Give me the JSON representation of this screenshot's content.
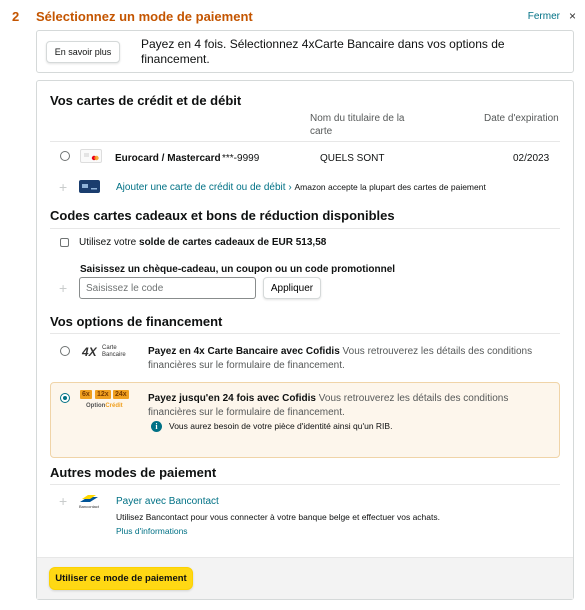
{
  "header": {
    "step_number": "2",
    "title": "Sélectionnez un mode de paiement",
    "close_label": "Fermer",
    "close_glyph": "×"
  },
  "info": {
    "learn_more_label": "En savoir plus",
    "text": "Payez en 4 fois. Sélectionnez 4xCarte Bancaire dans vos options de financement."
  },
  "cards": {
    "title": "Vos cartes de crédit et de débit",
    "col_holder": "Nom du titulaire de la carte",
    "col_expiry": "Date d'expiration",
    "rows": [
      {
        "name": "Eurocard / Mastercard",
        "number": "***-9999",
        "holder": "QUELS SONT",
        "expiry": "02/2023"
      }
    ],
    "add_card_label": "Ajouter une carte de crédit ou de débit",
    "add_card_separator": "›",
    "add_card_note": "Amazon accepte la plupart des cartes de paiement"
  },
  "gift": {
    "title": "Codes cartes cadeaux et bons de réduction disponibles",
    "use_balance_prefix": "Utilisez votre ",
    "use_balance_bold": "solde de cartes cadeaux de EUR 513,58",
    "enter_code_label": "Saisissez un chèque-cadeau, un coupon ou un code promotionnel",
    "input_placeholder": "Saisissez le code",
    "apply_label": "Appliquer"
  },
  "financing": {
    "title": "Vos options de financement",
    "options": [
      {
        "logo_main": "4X",
        "logo_line1": "Carte",
        "logo_line2": "Bancaire",
        "title": "Payez en 4x Carte Bancaire avec Cofidis",
        "desc_line1": " Vous retrouverez les détails des conditions",
        "desc_line2": "financières sur le formulaire de financement."
      },
      {
        "logo_badges": [
          "6x",
          "12x",
          "24x"
        ],
        "logo_option": "Option",
        "logo_credit": "Crédit",
        "title": "Payez jusqu'en 24 fois avec Cofidis",
        "desc_line1": " Vous retrouverez les détails des conditions",
        "desc_line2": "financières sur le formulaire de financement.",
        "note": "Vous aurez besoin de votre pièce d'identité ainsi qu'un RIB.",
        "info_glyph": "i"
      }
    ]
  },
  "other": {
    "title": "Autres modes de paiement",
    "bancontact_label": "Payer avec Bancontact",
    "bancontact_logo_text": "Bancontact",
    "bancontact_desc": "Utilisez Bancontact pour vous connecter à votre banque belge et effectuer vos achats.",
    "more_info": "Plus d'informations"
  },
  "footer": {
    "submit_label": "Utiliser ce mode de paiement"
  },
  "glyphs": {
    "plus": "+"
  },
  "colors": {
    "accent_orange": "#c45500",
    "link_teal": "#007185",
    "button_yellow": "#ffd814",
    "highlight_bg": "#fdf6ec"
  }
}
